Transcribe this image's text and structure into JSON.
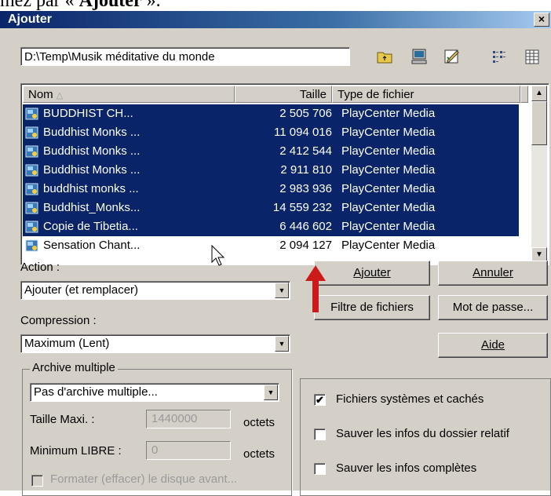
{
  "caption": {
    "prefix": "mez par «",
    "bold": "Ajouter",
    "suffix": "»."
  },
  "window": {
    "title": "Ajouter",
    "close": "×"
  },
  "path": "D:\\Temp\\Musik méditative du monde",
  "toolbar": {
    "icons": [
      "folder-up-icon",
      "computer-icon",
      "edit-icon",
      "list-view-icon",
      "details-view-icon"
    ]
  },
  "list": {
    "columns": {
      "name": "Nom",
      "size": "Taille",
      "type": "Type de fichier"
    },
    "rows": [
      {
        "name": "BUDDHIST CH...",
        "size": "2 505 706",
        "type": "PlayCenter Media",
        "selected": true
      },
      {
        "name": "Buddhist Monks ...",
        "size": "11 094 016",
        "type": "PlayCenter Media",
        "selected": true
      },
      {
        "name": "Buddhist Monks ...",
        "size": "2 412 544",
        "type": "PlayCenter Media",
        "selected": true
      },
      {
        "name": "Buddhist Monks ...",
        "size": "2 911 810",
        "type": "PlayCenter Media",
        "selected": true
      },
      {
        "name": "buddhist monks ...",
        "size": "2 983 936",
        "type": "PlayCenter Media",
        "selected": true
      },
      {
        "name": "Buddhist_Monks...",
        "size": "14 559 232",
        "type": "PlayCenter Media",
        "selected": true
      },
      {
        "name": "Copie de Tibetia...",
        "size": "6 446 602",
        "type": "PlayCenter Media",
        "selected": true
      },
      {
        "name": "Sensation Chant...",
        "size": "2 094 127",
        "type": "PlayCenter Media",
        "selected": false
      }
    ]
  },
  "action": {
    "label": "Action :",
    "value": "Ajouter (et remplacer)"
  },
  "compression": {
    "label": "Compression :",
    "value": "Maximum (Lent)"
  },
  "buttons": {
    "add": "Ajouter",
    "cancel": "Annuler",
    "filter": "Filtre de fichiers",
    "password": "Mot de passe...",
    "help": "Aide"
  },
  "archive": {
    "title": "Archive multiple",
    "value": "Pas d'archive multiple...",
    "max_label": "Taille Maxi. :",
    "max_value": "1440000",
    "max_unit": "octets",
    "min_label": "Minimum LIBRE :",
    "min_value": "0",
    "min_unit": "octets",
    "format_label": "Formater (effacer) le disque avant..."
  },
  "options": [
    {
      "label": "Fichiers systèmes et cachés",
      "checked": true
    },
    {
      "label": "Sauver les infos du dossier relatif",
      "checked": false
    },
    {
      "label": "Sauver les infos complètes",
      "checked": false
    }
  ],
  "colors": {
    "selection": "#0a246a",
    "face": "#d4d0c8",
    "arrow": "#cc1a1a"
  }
}
